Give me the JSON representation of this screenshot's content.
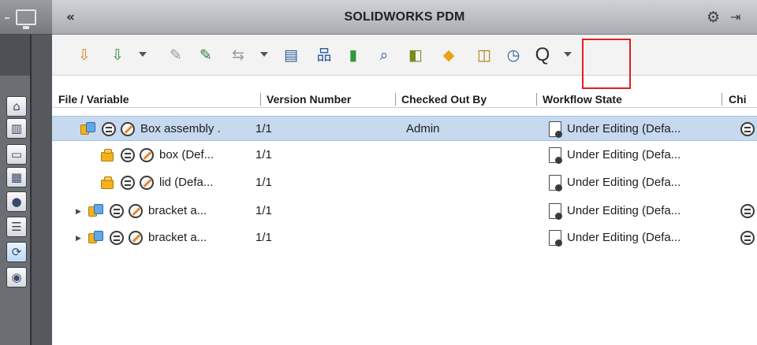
{
  "app": {
    "title": "SOLIDWORKS PDM",
    "collapse_glyph": "«"
  },
  "titlebar_icons": [
    "gear-icon",
    "pin-icon"
  ],
  "rail": {
    "buttons": [
      {
        "name": "home-icon",
        "glyph": "⌂"
      },
      {
        "name": "vault-icon",
        "glyph": "▥"
      },
      {
        "name": "folder-icon",
        "glyph": "▭"
      },
      {
        "name": "card-icon",
        "glyph": "▦"
      },
      {
        "name": "palette-icon",
        "glyph": "●"
      },
      {
        "name": "list-icon",
        "glyph": "☰"
      },
      {
        "name": "refresh-icon",
        "glyph": "⟳"
      },
      {
        "name": "globe-icon",
        "glyph": "◉"
      }
    ]
  },
  "toolbar": {
    "buttons": [
      {
        "name": "get-latest-version-icon",
        "glyph": "⇩",
        "color": "#d08a14"
      },
      {
        "name": "get-version-icon",
        "glyph": "⇩",
        "color": "#3c8b3a"
      },
      {
        "name": "check-in-icon",
        "glyph": "✎",
        "color": "#9a9a9a"
      },
      {
        "name": "check-out-icon",
        "glyph": "✎",
        "color": "#2e7d32"
      },
      {
        "name": "change-state-icon",
        "glyph": "⇆",
        "color": "#9a9a9a"
      },
      {
        "name": "data-card-icon",
        "glyph": "▤",
        "color": "#2a5a9a"
      },
      {
        "name": "where-used-icon",
        "glyph": "品",
        "color": "#2a5a9a"
      },
      {
        "name": "book-icon",
        "glyph": "▮",
        "color": "#2e9a3a"
      },
      {
        "name": "search-icon-1",
        "glyph": "⌕",
        "color": "#2a5a9a"
      },
      {
        "name": "undo-checkout-icon",
        "glyph": "◧",
        "color": "#7a8a22"
      },
      {
        "name": "assembly-icon",
        "glyph": "◆",
        "color": "#e5a31a"
      },
      {
        "name": "browse-icon",
        "glyph": "◫",
        "color": "#b07a0c"
      },
      {
        "name": "history-icon",
        "glyph": "◷",
        "color": "#2a5a9a"
      },
      {
        "name": "search-icon",
        "glyph": "Q",
        "color": "#2e2e2e"
      }
    ]
  },
  "columns": [
    {
      "key": "file",
      "label": "File / Variable"
    },
    {
      "key": "version",
      "label": "Version Number"
    },
    {
      "key": "checked_out_by",
      "label": "Checked Out By"
    },
    {
      "key": "workflow",
      "label": "Workflow State"
    },
    {
      "key": "child",
      "label": "Chi"
    }
  ],
  "rows": [
    {
      "type": "assembly",
      "expander": "",
      "name": "Box assembly .",
      "version": "1/1",
      "checked_out_by": "Admin",
      "workflow": "Under Editing (Defa...",
      "child": true,
      "selected": true
    },
    {
      "type": "part",
      "expander": "",
      "name": "box  (Def...",
      "version": "1/1",
      "checked_out_by": "",
      "workflow": "Under Editing (Defa...",
      "child": false,
      "selected": false
    },
    {
      "type": "part",
      "expander": "",
      "name": "lid  (Defa...",
      "version": "1/1",
      "checked_out_by": "",
      "workflow": "Under Editing (Defa...",
      "child": false,
      "selected": false
    },
    {
      "type": "assembly",
      "expander": "▶",
      "name": "bracket a...",
      "version": "1/1",
      "checked_out_by": "",
      "workflow": "Under Editing (Defa...",
      "child": true,
      "selected": false
    },
    {
      "type": "assembly",
      "expander": "▶",
      "name": "bracket a...",
      "version": "1/1",
      "checked_out_by": "",
      "workflow": "Under Editing (Defa...",
      "child": true,
      "selected": false
    }
  ]
}
